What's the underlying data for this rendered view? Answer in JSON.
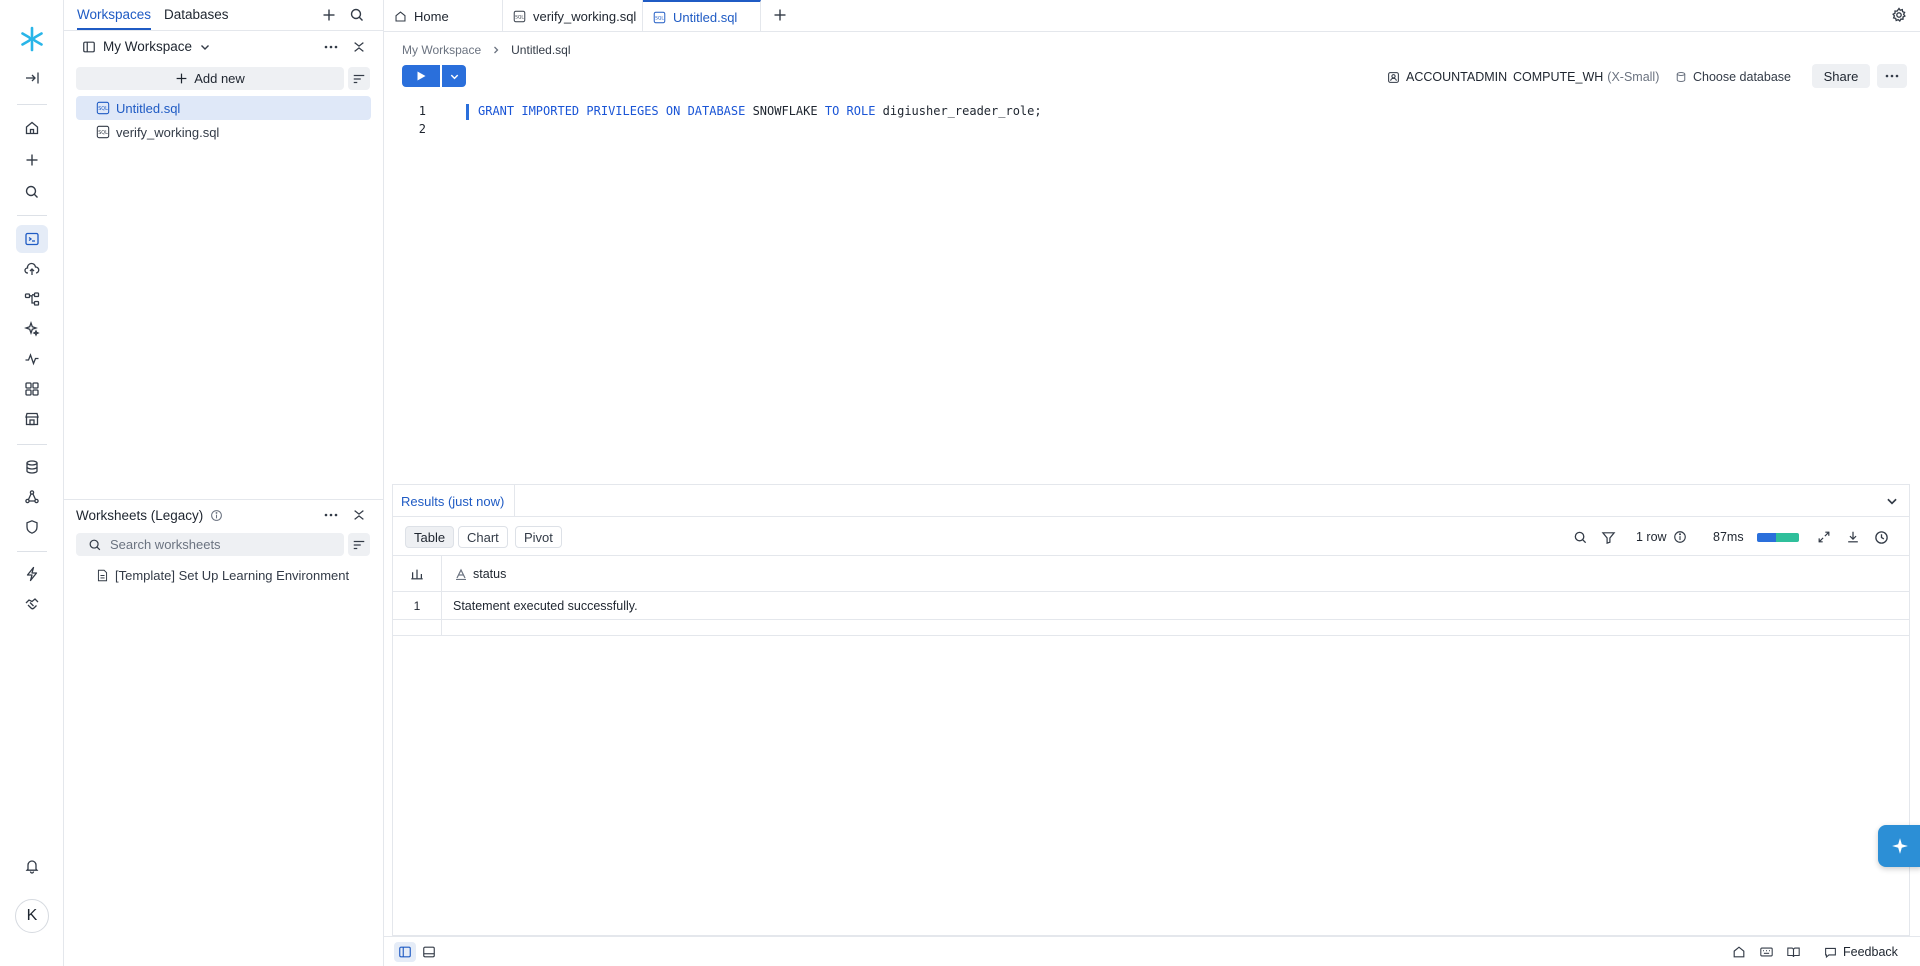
{
  "colors": {
    "accent": "#1f5bc4",
    "run_button": "#2a6fdb",
    "keyword": "#1a55d6",
    "ai_button": "#2c8fd6",
    "logo": "#29b5e8",
    "timing_compile": "#2a6fdb",
    "timing_exec": "#2fbf9b"
  },
  "rail": {
    "logo_icon": "snowflake-icon",
    "items": [
      "collapse-sidebar-icon",
      "home-icon",
      "plus-icon",
      "search-icon",
      "worksheets-icon",
      "data-upload-icon",
      "projects-icon",
      "ai-ml-icon",
      "monitoring-icon",
      "marketplace-icon",
      "apps-icon",
      "database-icon",
      "admin-icon",
      "governance-icon",
      "lightning-icon",
      "partner-connect-icon",
      "notifications-icon"
    ],
    "avatar_initial": "K"
  },
  "ws_panel": {
    "tabs": [
      "Workspaces",
      "Databases"
    ],
    "active_tab": "Workspaces",
    "workspace_name": "My Workspace",
    "add_new_label": "Add new",
    "files": [
      "Untitled.sql",
      "verify_working.sql"
    ],
    "active_file": "Untitled.sql",
    "legacy_title": "Worksheets (Legacy)",
    "search_placeholder": "Search worksheets",
    "legacy_items": [
      "[Template] Set Up Learning Environment"
    ]
  },
  "doc_tabs": [
    "Home",
    "verify_working.sql",
    "Untitled.sql"
  ],
  "active_doc_tab": "Untitled.sql",
  "breadcrumb": {
    "workspace": "My Workspace",
    "file": "Untitled.sql"
  },
  "context": {
    "role": "ACCOUNTADMIN",
    "warehouse": "COMPUTE_WH",
    "warehouse_size": "(X-Small)",
    "database": "Choose database",
    "share_label": "Share"
  },
  "editor": {
    "line_numbers": [
      "1",
      "2"
    ],
    "code_tokens": [
      {
        "t": "GRANT",
        "k": "kw"
      },
      {
        "t": " ",
        "k": "id"
      },
      {
        "t": "IMPORTED",
        "k": "kw"
      },
      {
        "t": " ",
        "k": "id"
      },
      {
        "t": "PRIVILEGES",
        "k": "kw"
      },
      {
        "t": " ",
        "k": "id"
      },
      {
        "t": "ON",
        "k": "kw"
      },
      {
        "t": " ",
        "k": "id"
      },
      {
        "t": "DATABASE",
        "k": "kw"
      },
      {
        "t": " SNOWFLAKE ",
        "k": "id"
      },
      {
        "t": "TO",
        "k": "kw"
      },
      {
        "t": " ",
        "k": "id"
      },
      {
        "t": "ROLE",
        "k": "kw"
      },
      {
        "t": " digiusher_reader_role;",
        "k": "id"
      }
    ]
  },
  "results": {
    "title": "Results (just now)",
    "views": [
      "Table",
      "Chart",
      "Pivot"
    ],
    "active_view": "Table",
    "row_count": "1 row",
    "duration": "87ms",
    "timing_split": {
      "compile": 0.45,
      "execution": 0.55
    },
    "column_header": "status",
    "rows": [
      {
        "num": "1",
        "status": "Statement executed successfully."
      }
    ]
  },
  "statusbar": {
    "feedback_label": "Feedback"
  }
}
